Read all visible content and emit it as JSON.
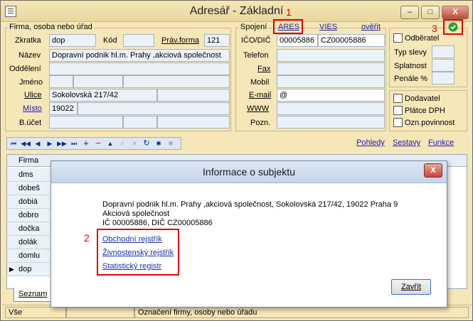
{
  "window": {
    "title": "Adresář - Základní",
    "minimize": "–",
    "maximize": "□",
    "close": "X"
  },
  "firma": {
    "legend": "Firma, osoba nebo úřad",
    "zkratka_label": "Zkratka",
    "zkratka_value": "dop",
    "kod_label": "Kód",
    "kod_value": "",
    "pravforma_label": "Práv.forma",
    "pravforma_value": "121",
    "nazev_label": "Název",
    "nazev_value": "Dopravní podnik hl.m. Prahy ,akciová společnost",
    "oddeleni_label": "Oddělení",
    "jmeno_label": "Jméno",
    "ulice_label": "Ulice",
    "ulice_value": "Sokolovská 217/42",
    "misto_label": "Místo",
    "misto_value": "19022",
    "bucet_label": "B.účet"
  },
  "spojeni": {
    "legend": "Spojení",
    "ares": "ARES",
    "vies": "VIES",
    "overit": "ověřit",
    "ico_label": "IČO/DIČ",
    "ico_value": "00005886",
    "dic_value": "CZ00005886",
    "telefon_label": "Telefon",
    "fax_label": "Fax",
    "mobil_label": "Mobil",
    "email_label": "E-mail",
    "email_value": "@",
    "www_label": "WWW",
    "pozn_label": "Pozn."
  },
  "right_panel": {
    "odberatel": "Odběratel",
    "typ_slevy": "Typ slevy",
    "splatnost": "Splatnost",
    "penale": "Penále %",
    "dodavatel": "Dodavatel",
    "platce_dph": "Plátce DPH",
    "ozn_povinnost": "Ozn.povinnost"
  },
  "annotations": {
    "n1": "1",
    "n2": "2",
    "n3": "3"
  },
  "toolbar_links": {
    "pohledy": "Pohledy",
    "sestavy": "Sestavy",
    "funkce": "Funkce"
  },
  "nav_buttons": [
    "⏮",
    "◀◀",
    "◀",
    "▶",
    "▶▶",
    "⏭",
    "+",
    "−",
    "▲",
    "✓",
    "✕",
    "↻",
    "✱",
    "✱"
  ],
  "grid": {
    "col_firma": "Firma",
    "rows": [
      "dms",
      "dobeš",
      "dobiá",
      "dobro",
      "dočka",
      "dolák",
      "domlu",
      "dop"
    ]
  },
  "tab_seznam": "Seznam",
  "status": {
    "left": "Vše",
    "middle": "Označení firmy, osoby nebo úřadu"
  },
  "dialog": {
    "title": "Informace o subjektu",
    "line1": "Dopravní podnik hl.m. Prahy ,akciová společnost, Sokolovská 217/42, 19022 Praha 9",
    "line2": "Akciová společnost",
    "line3": "IČ 00005886, DIČ CZ00005886",
    "link_obchodni": "Obchodní rejstřík",
    "link_zivnostensky": "Živnostenský rejstřík",
    "link_statisticky": "Statistický registr",
    "close_button": "Zavřít",
    "close_x": "X"
  },
  "colors": {
    "window_bg": "#f5e7b8",
    "field_bg": "#eaf1f9",
    "annotation_red": "#e00000",
    "link_blue": "#2020b0"
  }
}
